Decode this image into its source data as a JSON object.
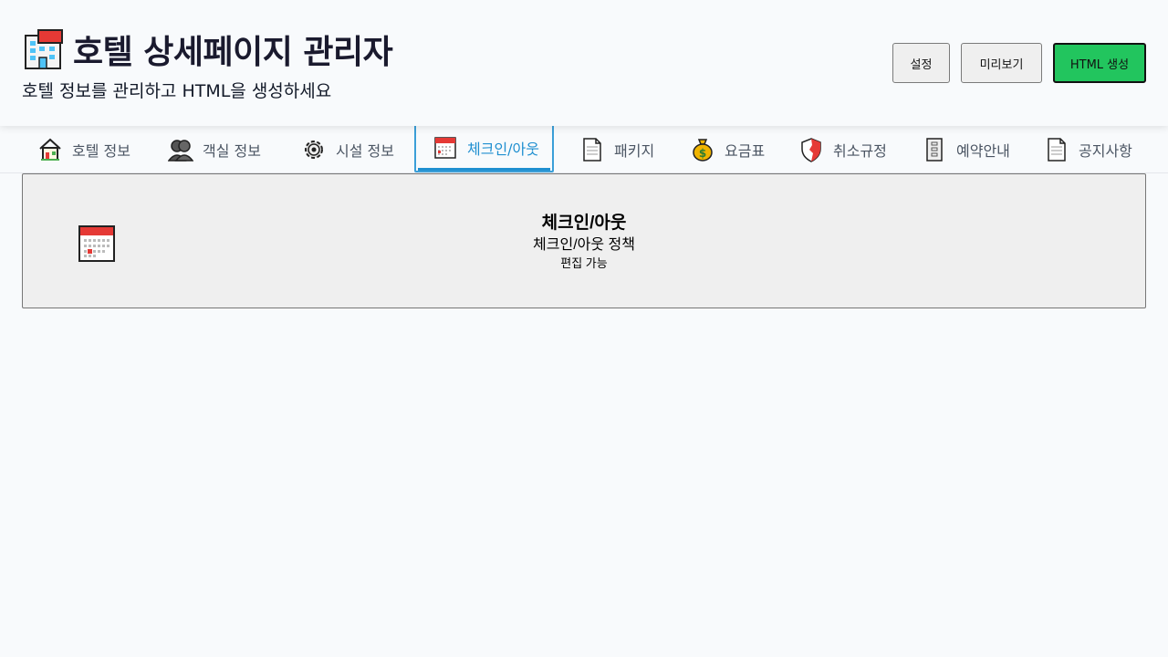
{
  "header": {
    "title": "호텔 상세페이지 관리자",
    "subtitle": "호텔 정보를 관리하고 HTML을 생성하세요",
    "title_icon": "hotel-icon"
  },
  "actions": {
    "settings_label": "설정",
    "preview_label": "미리보기",
    "generate_label": "HTML 생성"
  },
  "tabs": [
    {
      "label": "호텔 정보",
      "icon": "house-icon"
    },
    {
      "label": "객실 정보",
      "icon": "people-icon"
    },
    {
      "label": "시설 정보",
      "icon": "gear-icon"
    },
    {
      "label": "체크인/아웃",
      "icon": "calendar-icon",
      "active": true
    },
    {
      "label": "패키지",
      "icon": "document-icon"
    },
    {
      "label": "요금표",
      "icon": "money-bag-icon"
    },
    {
      "label": "취소규정",
      "icon": "shield-icon"
    },
    {
      "label": "예약안내",
      "icon": "pager-icon"
    },
    {
      "label": "공지사항",
      "icon": "document-icon"
    }
  ],
  "panel": {
    "title": "체크인/아웃",
    "description": "체크인/아웃 정책",
    "hint": "편집 가능",
    "icon": "calendar-icon"
  },
  "colors": {
    "background": "#f8fafc",
    "accent": "#1f8fd0",
    "generate_button": "#22c55e",
    "card_background": "#efefef"
  }
}
